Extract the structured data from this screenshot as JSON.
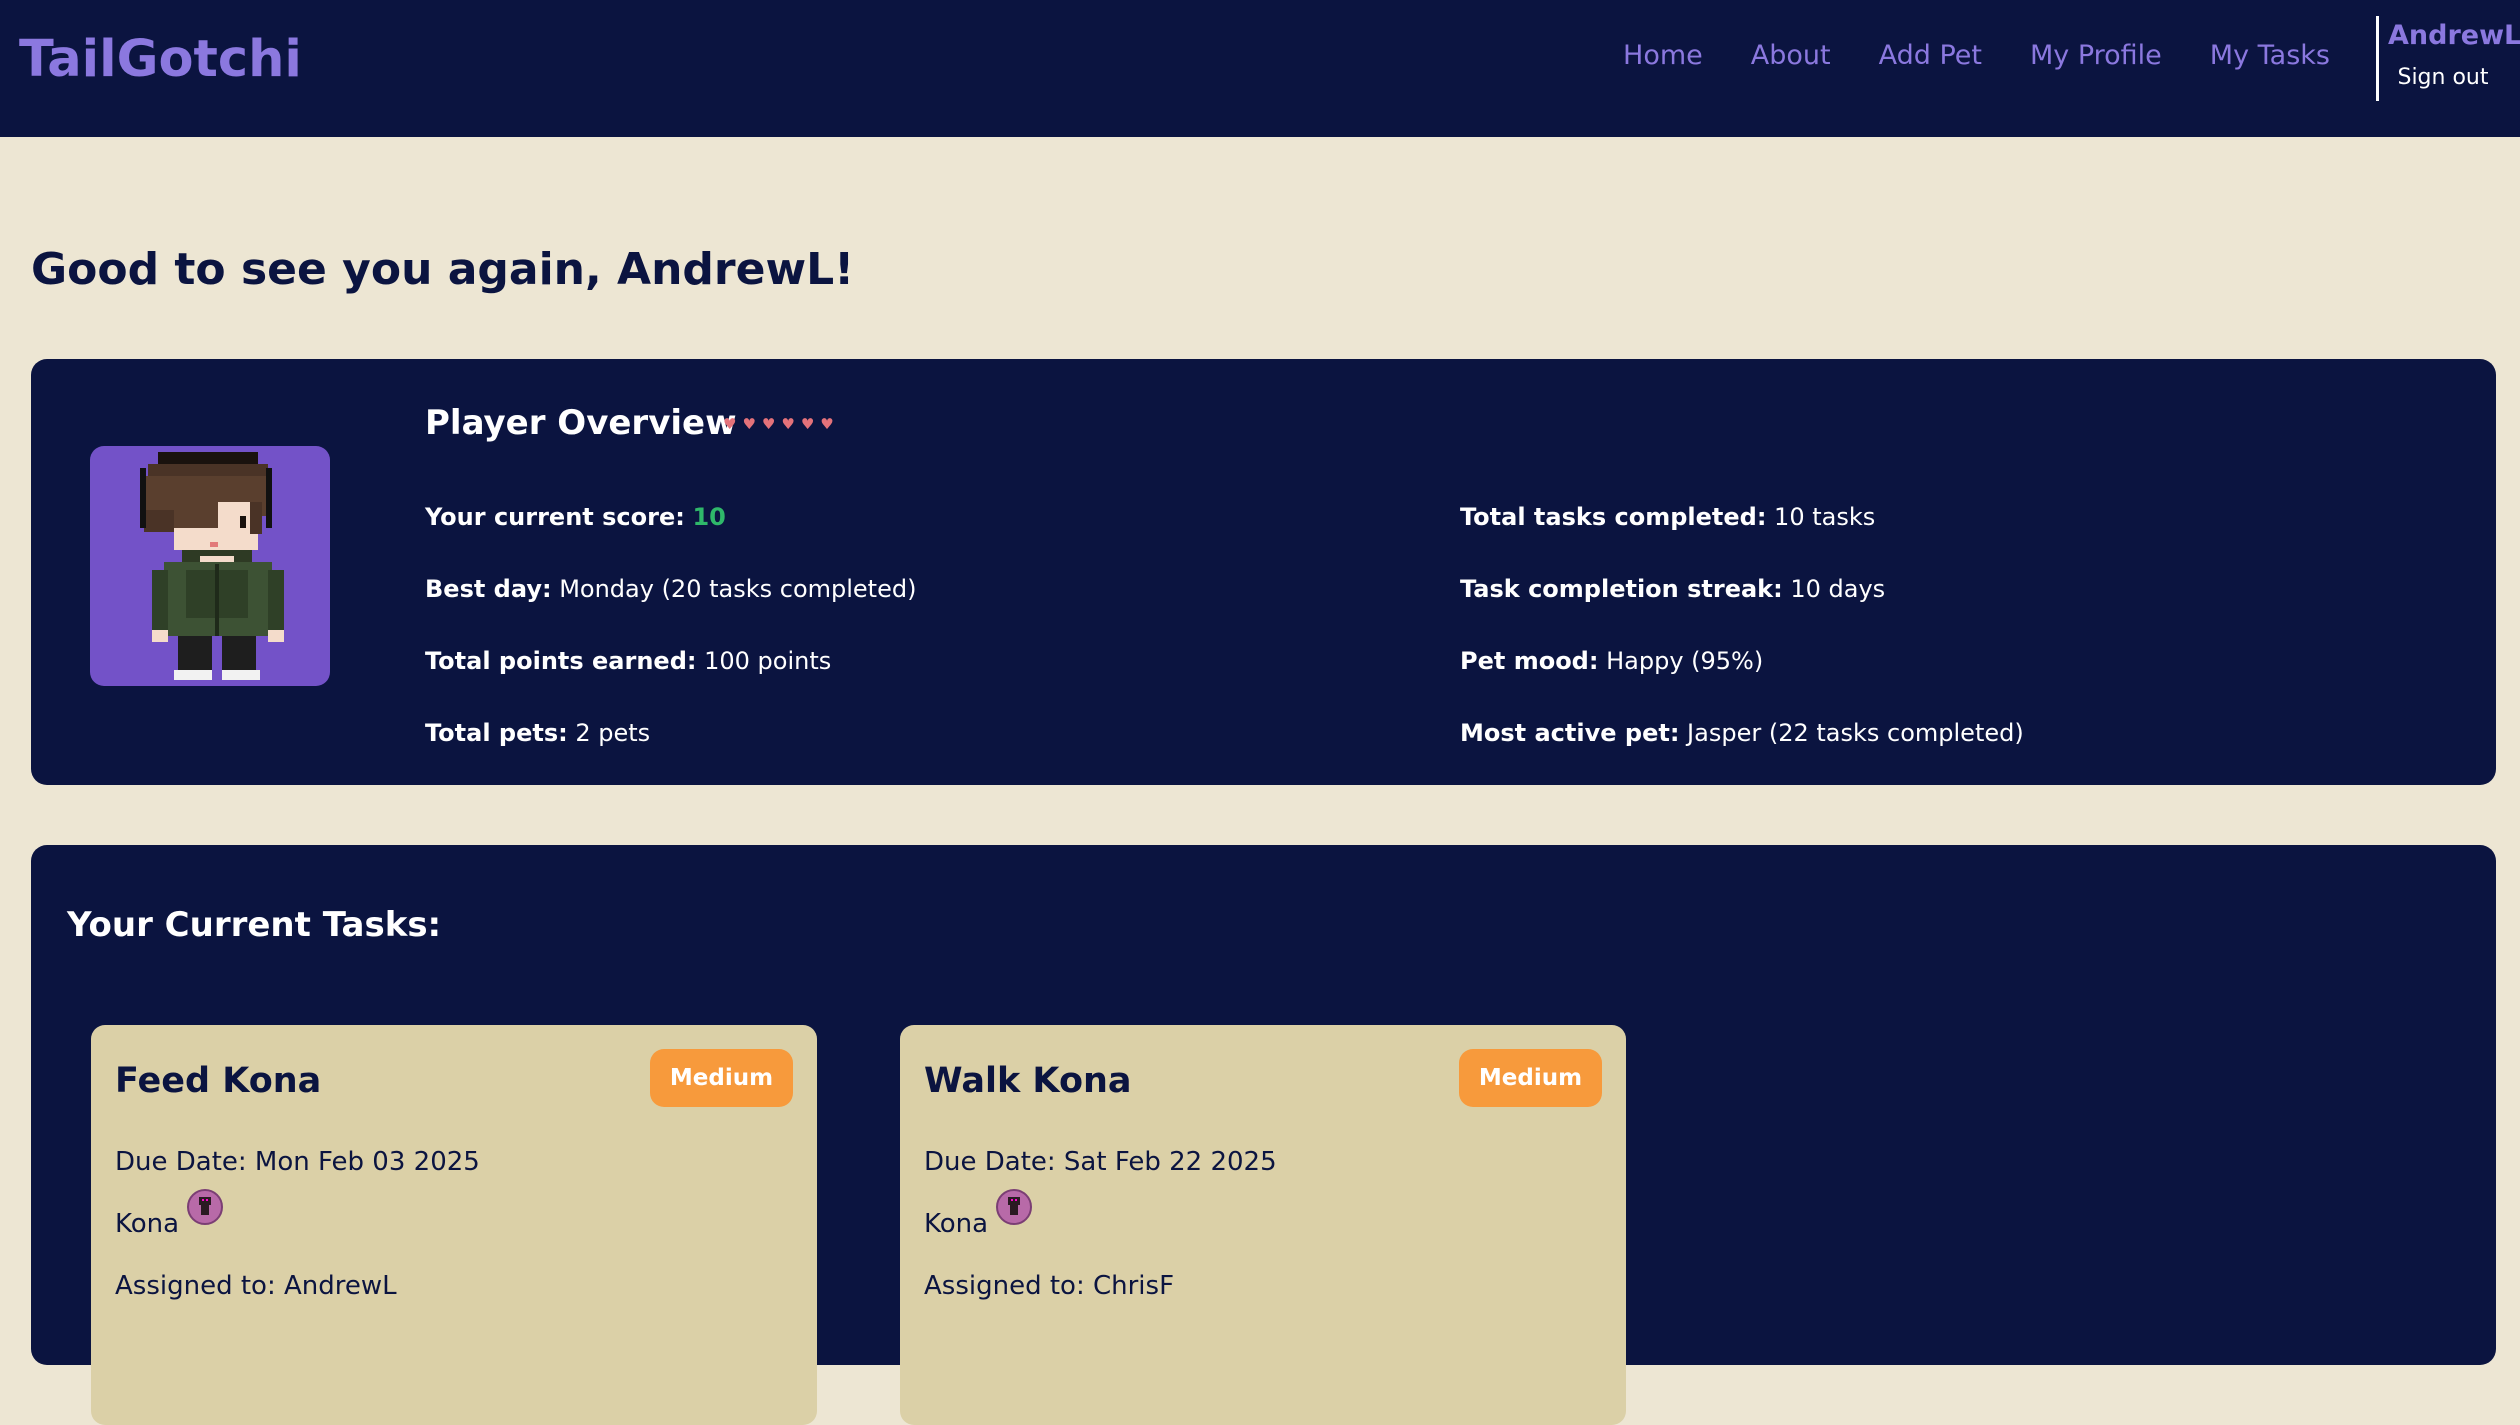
{
  "nav": {
    "brand": "TailGotchi",
    "links": [
      "Home",
      "About",
      "Add Pet",
      "My Profile",
      "My Tasks"
    ],
    "username": "AndrewL",
    "sign_out": "Sign out"
  },
  "greeting": "Good to see you again, AndrewL!",
  "overview": {
    "title": "Player Overview",
    "hearts": [
      "♥",
      "♥",
      "♥",
      "♥",
      "♥",
      "♥"
    ],
    "stats_left": [
      {
        "label": "Your current score:",
        "value": "10"
      },
      {
        "label": "Best day:",
        "value": " Monday (20 tasks completed)"
      },
      {
        "label": "Total points earned:",
        "value": " 100 points"
      },
      {
        "label": "Total pets:",
        "value": " 2 pets"
      }
    ],
    "stats_right": [
      {
        "label": "Total tasks completed:",
        "value": " 10 tasks"
      },
      {
        "label": "Task completion streak:",
        "value": " 10 days"
      },
      {
        "label": "Pet mood:",
        "value": " Happy (95%)"
      },
      {
        "label": "Most active pet:",
        "value": " Jasper (22 tasks completed)"
      }
    ],
    "colors": {
      "score": "#2fb86a",
      "avatar_bg": "#7352c8",
      "hearts": "#e4727a"
    },
    "avatar_icon": "player-avatar-pixel"
  },
  "tasks": {
    "title": "Your Current Tasks:",
    "items": [
      {
        "name": "Feed Kona",
        "priority": "Medium",
        "due": "Due Date: Mon Feb 03 2025",
        "pet": "Kona",
        "assigned": "Assigned to: AndrewL"
      },
      {
        "name": "Walk Kona",
        "priority": "Medium",
        "due": "Due Date: Sat Feb 22 2025",
        "pet": "Kona",
        "assigned": "Assigned to: ChrisF"
      }
    ],
    "colors": {
      "card_bg": "#dbd0a7",
      "priority_bg": "#f79a3c"
    }
  }
}
